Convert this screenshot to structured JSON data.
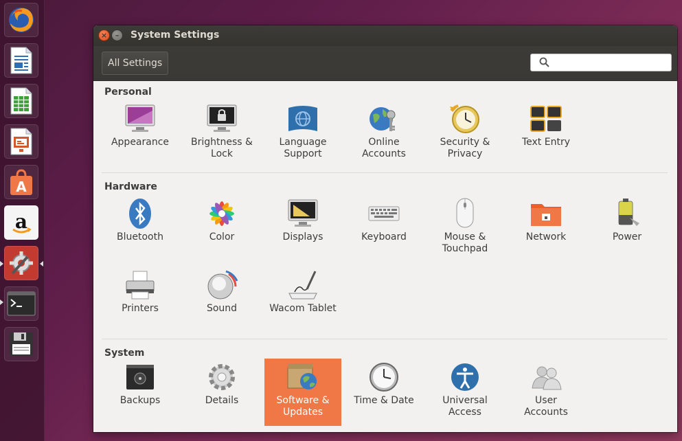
{
  "window": {
    "title": "System Settings",
    "all_settings_label": "All Settings",
    "search_placeholder": ""
  },
  "launcher": [
    {
      "name": "firefox-icon"
    },
    {
      "name": "libreoffice-writer-icon"
    },
    {
      "name": "libreoffice-calc-icon"
    },
    {
      "name": "libreoffice-impress-icon"
    },
    {
      "name": "ubuntu-software-center-icon"
    },
    {
      "name": "amazon-icon"
    },
    {
      "name": "system-settings-icon"
    },
    {
      "name": "terminal-icon"
    },
    {
      "name": "save-disk-icon"
    }
  ],
  "sections": {
    "personal": {
      "title": "Personal",
      "items": [
        "Appearance",
        "Brightness &\nLock",
        "Language\nSupport",
        "Online\nAccounts",
        "Security &\nPrivacy",
        "Text Entry"
      ]
    },
    "hardware": {
      "title": "Hardware",
      "items": [
        "Bluetooth",
        "Color",
        "Displays",
        "Keyboard",
        "Mouse &\nTouchpad",
        "Network",
        "Power",
        "Printers",
        "Sound",
        "Wacom Tablet"
      ]
    },
    "system": {
      "title": "System",
      "items": [
        "Backups",
        "Details",
        "Software &\nUpdates",
        "Time & Date",
        "Universal\nAccess",
        "User\nAccounts"
      ]
    }
  },
  "selected_item": "Software &\nUpdates",
  "colors": {
    "accent": "#f07746",
    "titlebar": "#3c3b37"
  }
}
